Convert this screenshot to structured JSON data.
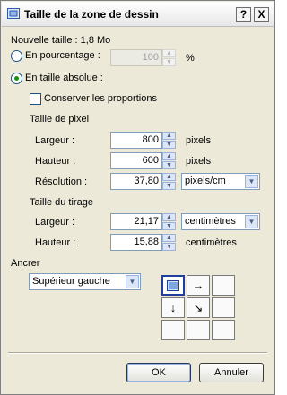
{
  "window": {
    "title": "Taille de la zone de dessin",
    "help_glyph": "?",
    "close_glyph": "X"
  },
  "new_size": "Nouvelle taille : 1,8 Mo",
  "percentage": {
    "label": "En pourcentage :",
    "value": "100",
    "unit": "%",
    "checked": false
  },
  "absolute": {
    "label": "En taille absolue :",
    "checked": true
  },
  "keep_proportions": {
    "label": "Conserver les proportions",
    "checked": false
  },
  "pixel_size": {
    "heading": "Taille de pixel",
    "width": {
      "label": "Largeur :",
      "value": "800",
      "unit": "pixels"
    },
    "height": {
      "label": "Hauteur :",
      "value": "600",
      "unit": "pixels"
    },
    "resolution": {
      "label": "Résolution :",
      "value": "37,80",
      "unit": "pixels/cm"
    }
  },
  "print_size": {
    "heading": "Taille du tirage",
    "width": {
      "label": "Largeur :",
      "value": "21,17",
      "unit": "centimètres"
    },
    "height": {
      "label": "Hauteur :",
      "value": "15,88",
      "unit": "centimètres"
    }
  },
  "anchor": {
    "label": "Ancrer",
    "value": "Supérieur gauche",
    "grid": [
      "",
      "→",
      "",
      "↓",
      "↘",
      "",
      "",
      "",
      ""
    ]
  },
  "buttons": {
    "ok": "OK",
    "cancel": "Annuler"
  }
}
